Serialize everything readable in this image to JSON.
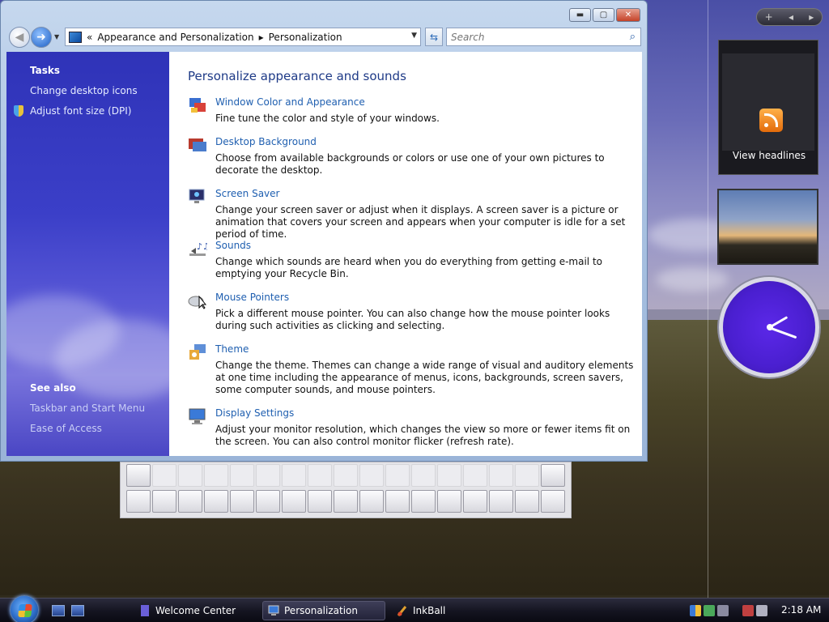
{
  "window": {
    "address": {
      "back_chevrons": "«",
      "crumb1": "Appearance and Personalization",
      "sep": "▸",
      "crumb2": "Personalization"
    },
    "search_placeholder": "Search"
  },
  "left_pane": {
    "tasks_heading": "Tasks",
    "tasks": [
      "Change desktop icons",
      "Adjust font size (DPI)"
    ],
    "see_also_heading": "See also",
    "see_also": [
      "Taskbar and Start Menu",
      "Ease of Access"
    ]
  },
  "content": {
    "title": "Personalize appearance and sounds",
    "items": [
      {
        "title": "Window Color and Appearance",
        "desc": "Fine tune the color and style of your windows.",
        "icon": "window-color-icon"
      },
      {
        "title": "Desktop Background",
        "desc": "Choose from available backgrounds or colors or use one of your own pictures to decorate the desktop.",
        "icon": "desktop-background-icon"
      },
      {
        "title": "Screen Saver",
        "desc": "Change your screen saver or adjust when it displays. A screen saver is a picture or animation that covers your screen and appears when your computer is idle for a set period of time.",
        "icon": "screen-saver-icon"
      },
      {
        "title": "Sounds",
        "desc": "Change which sounds are heard when you do everything from getting e-mail to emptying your Recycle Bin.",
        "icon": "sounds-icon"
      },
      {
        "title": "Mouse Pointers",
        "desc": "Pick a different mouse pointer. You can also change how the mouse pointer looks during such activities as clicking and selecting.",
        "icon": "mouse-pointer-icon"
      },
      {
        "title": "Theme",
        "desc": "Change the theme. Themes can change a wide range of visual and auditory elements at one time including the appearance of menus, icons, backgrounds, screen savers, some computer sounds, and mouse pointers.",
        "icon": "theme-icon"
      },
      {
        "title": "Display Settings",
        "desc": "Adjust your monitor resolution, which changes the view so more or fewer items fit on the screen. You can also control monitor flicker (refresh rate).",
        "icon": "display-settings-icon"
      }
    ]
  },
  "gadgets": {
    "toolbar_add": "+",
    "toolbar_prev": "◂",
    "toolbar_next": "▸",
    "feed_label": "View headlines"
  },
  "taskbar": {
    "items": [
      "Welcome Center",
      "Personalization",
      "InkBall"
    ],
    "time": "2:18 AM"
  }
}
